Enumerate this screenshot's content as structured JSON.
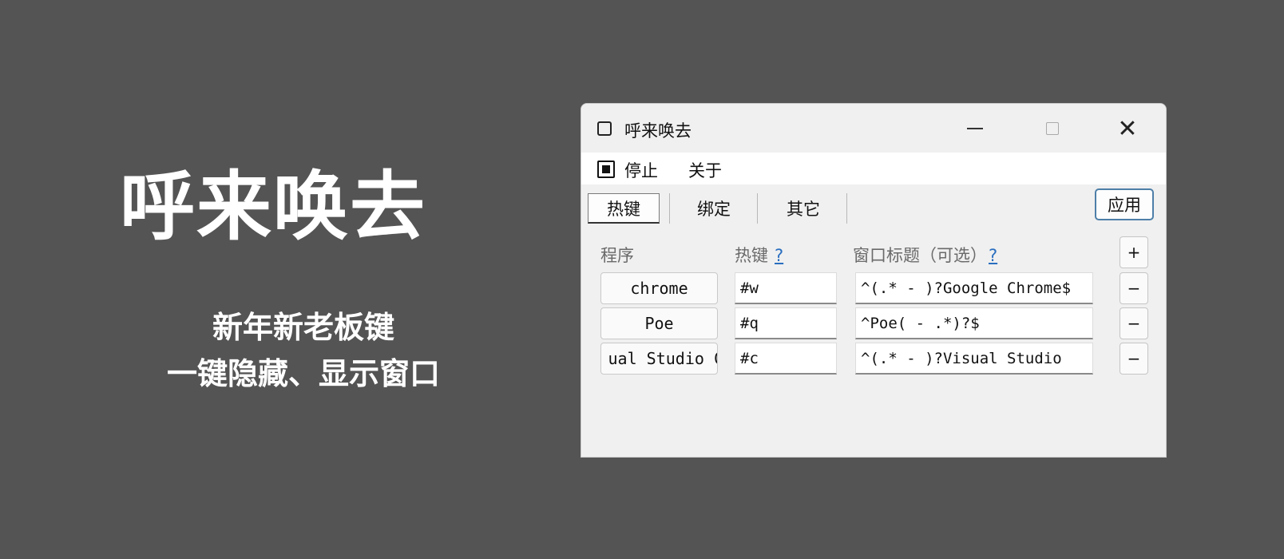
{
  "hero": {
    "title": "呼来唤去",
    "subtitle_1": "新年新老板键",
    "subtitle_2": "一键隐藏、显示窗口"
  },
  "window": {
    "title": "呼来唤去",
    "controls": {
      "minimize": "minimize",
      "maximize": "maximize",
      "close": "✕"
    }
  },
  "menu": {
    "stop": "停止",
    "about": "关于"
  },
  "tabs": [
    {
      "label": "热键",
      "active": true
    },
    {
      "label": "绑定",
      "active": false
    },
    {
      "label": "其它",
      "active": false
    }
  ],
  "apply_label": "应用",
  "columns": {
    "program": "程序",
    "hotkey": "热键",
    "hotkey_help": "?",
    "title": "窗口标题（可选）",
    "title_help": "?"
  },
  "add_label": "+",
  "rows": [
    {
      "program": "chrome",
      "hotkey": "#w",
      "title": "^(.* - )?Google Chrome$",
      "remove": "−"
    },
    {
      "program": "Poe",
      "hotkey": "#q",
      "title": "^Poe( - .*)?$",
      "remove": "−"
    },
    {
      "program": "ual Studio C",
      "hotkey": "#c",
      "title": "^(.* - )?Visual Studio",
      "remove": "−"
    }
  ],
  "colors": {
    "background": "#545454",
    "window": "#f0f0f0",
    "accent_border": "#4d7fa8",
    "link": "#2a6ebf"
  }
}
